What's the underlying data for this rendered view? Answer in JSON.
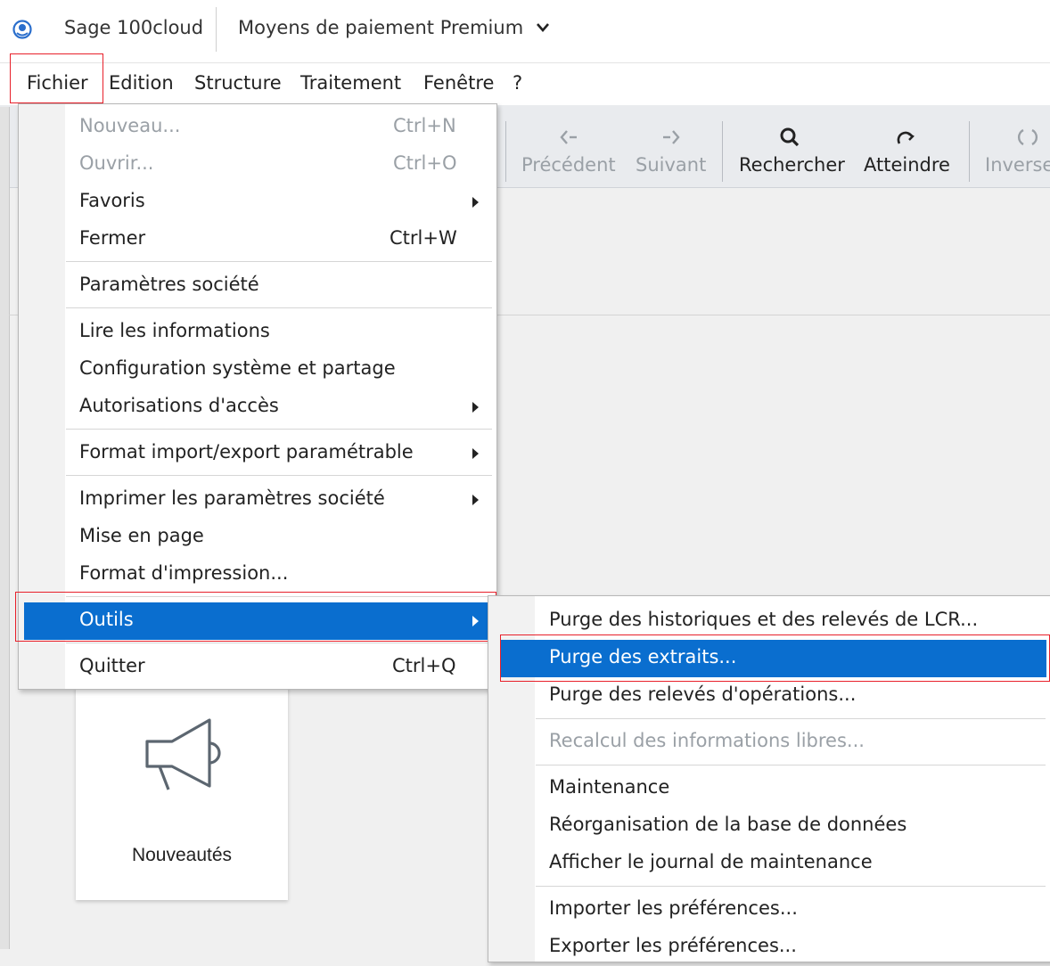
{
  "titlebar": {
    "app_name": "Sage 100cloud",
    "product": "Moyens de paiement Premium"
  },
  "menubar": [
    "Fichier",
    "Edition",
    "Structure",
    "Traitement",
    "Fenêtre",
    "?"
  ],
  "toolbar": {
    "previous": "Précédent",
    "next": "Suivant",
    "search": "Rechercher",
    "goto": "Atteindre",
    "inverse": "Inverse"
  },
  "card": {
    "label": "Nouveautés"
  },
  "file_menu": [
    {
      "label": "Nouveau...",
      "shortcut": "Ctrl+N"
    },
    {
      "label": "Ouvrir...",
      "shortcut": "Ctrl+O"
    },
    {
      "label": "Favoris"
    },
    {
      "label": "Fermer",
      "shortcut": "Ctrl+W"
    },
    {
      "label": "Paramètres société"
    },
    {
      "label": "Lire les informations"
    },
    {
      "label": "Configuration système et partage"
    },
    {
      "label": "Autorisations d'accès"
    },
    {
      "label": "Format import/export paramétrable"
    },
    {
      "label": "Imprimer les paramètres société"
    },
    {
      "label": "Mise en page"
    },
    {
      "label": "Format d'impression..."
    },
    {
      "label": "Outils"
    },
    {
      "label": "Quitter",
      "shortcut": "Ctrl+Q"
    }
  ],
  "tools_menu": [
    {
      "label": "Purge des historiques et des relevés de LCR..."
    },
    {
      "label": "Purge des extraits..."
    },
    {
      "label": "Purge des relevés d'opérations..."
    },
    {
      "label": "Recalcul des informations libres..."
    },
    {
      "label": "Maintenance"
    },
    {
      "label": "Réorganisation de la base de données"
    },
    {
      "label": "Afficher le journal de maintenance"
    },
    {
      "label": "Importer les préférences..."
    },
    {
      "label": "Exporter les préférences..."
    }
  ],
  "colors": {
    "highlight": "#0a6ecf",
    "annotation": "#e8202a"
  }
}
